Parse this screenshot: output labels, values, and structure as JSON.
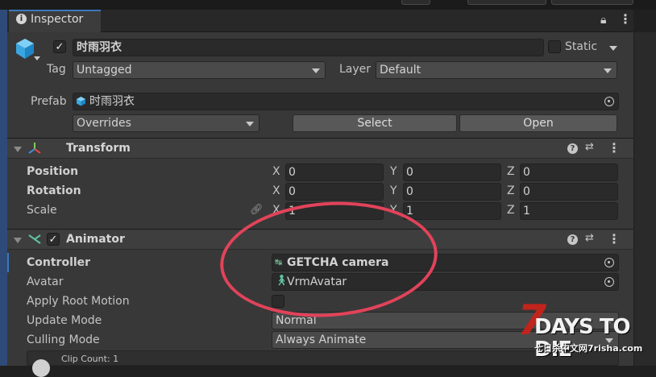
{
  "tab": {
    "title": "Inspector"
  },
  "gameobject": {
    "name": "时雨羽衣",
    "active": true,
    "static_label": "Static",
    "tag_label": "Tag",
    "tag_value": "Untagged",
    "layer_label": "Layer",
    "layer_value": "Default",
    "prefab_label": "Prefab",
    "prefab_value": "时雨羽衣",
    "overrides_label": "Overrides",
    "select_label": "Select",
    "open_label": "Open"
  },
  "transform": {
    "title": "Transform",
    "rows": [
      {
        "label": "Position",
        "x": "0",
        "y": "0",
        "z": "0"
      },
      {
        "label": "Rotation",
        "x": "0",
        "y": "0",
        "z": "0"
      },
      {
        "label": "Scale",
        "x": "1",
        "y": "1",
        "z": "1"
      }
    ],
    "axis": {
      "x": "X",
      "y": "Y",
      "z": "Z"
    }
  },
  "animator": {
    "title": "Animator",
    "enabled": true,
    "controller_label": "Controller",
    "controller_value": "GETCHA camera",
    "avatar_label": "Avatar",
    "avatar_value": "VrmAvatar",
    "apply_root_motion_label": "Apply Root Motion",
    "update_mode_label": "Update Mode",
    "update_mode_value": "Normal",
    "culling_mode_label": "Culling Mode",
    "culling_mode_value": "Always Animate",
    "clip_count": "Clip Count: 1"
  },
  "watermark": {
    "number": "7",
    "title": "DAYS TO DIE",
    "subtitle": "七日杀中文网7risha.com"
  },
  "colors": {
    "accent": "#3a79bb",
    "annotation": "#e2435a",
    "watermark_red": "#c0241c"
  }
}
